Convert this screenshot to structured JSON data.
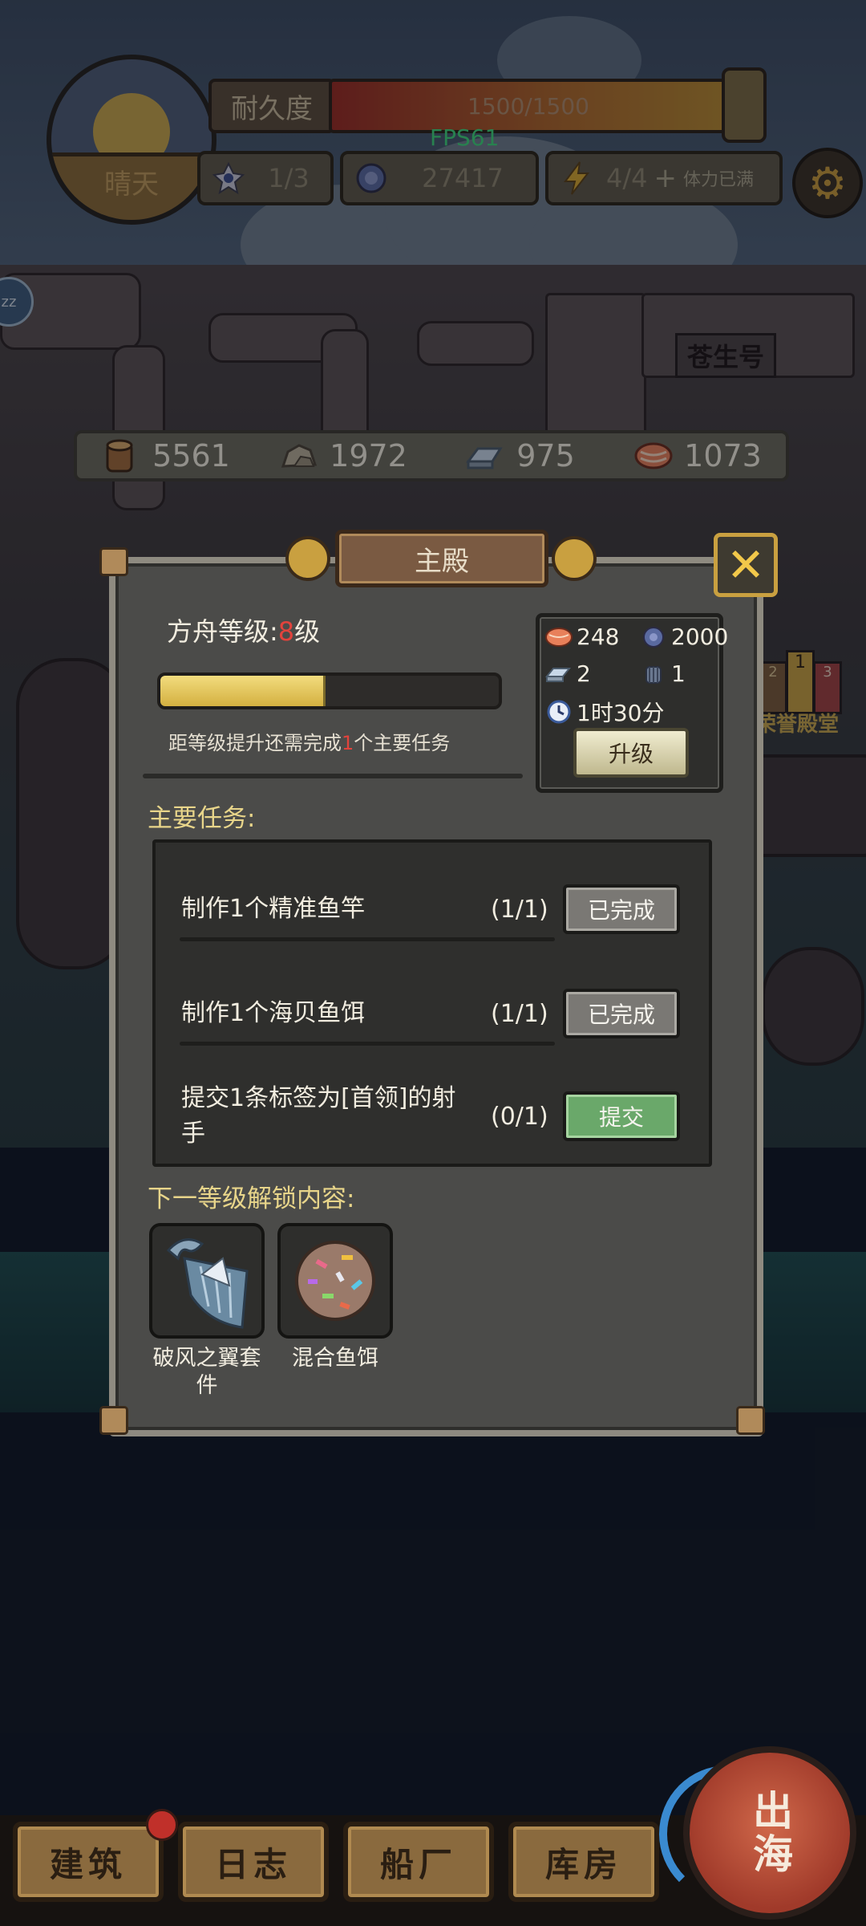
{
  "hud": {
    "weather": "晴天",
    "durability_label": "耐久度",
    "durability_value": "1500/1500",
    "durability_fraction": 1.0,
    "fps": "FPS61",
    "crew": "1/3",
    "coins": "27417",
    "energy": "4/4",
    "energy_plus": "+",
    "energy_status": "体力已满"
  },
  "scene": {
    "ship_name": "苍生号",
    "side_building": "荣誉殿堂",
    "side_ranks": [
      "2",
      "1",
      "3"
    ],
    "zz": "zz"
  },
  "resources": [
    {
      "icon": "wood-icon",
      "value": "5561"
    },
    {
      "icon": "stone-icon",
      "value": "1972"
    },
    {
      "icon": "iron-icon",
      "value": "975"
    },
    {
      "icon": "fish-meat-icon",
      "value": "1073"
    }
  ],
  "dialog": {
    "title": "主殿",
    "level_label": "方舟等级:",
    "level": "8",
    "level_unit": "级",
    "progress_fraction": 0.48,
    "hint_prefix": "距等级提升还需完成",
    "hint_count": "1",
    "hint_suffix": "个主要任务",
    "requirements": {
      "fish": "248",
      "coins": "2000",
      "iron": "2",
      "part": "1",
      "time": "1时30分"
    },
    "upgrade_label": "升级",
    "tasks_title": "主要任务:",
    "tasks": [
      {
        "name": "制作1个精准鱼竿",
        "count": "(1/1)",
        "button": "已完成"
      },
      {
        "name": "制作1个海贝鱼饵",
        "count": "(1/1)",
        "button": "已完成"
      },
      {
        "name": "提交1条标签为[首领]的射手",
        "count": "(0/1)",
        "button": "提交"
      }
    ],
    "unlock_title": "下一等级解锁内容:",
    "unlocks": [
      {
        "name": "破风之翼套件",
        "icon": "wing-kit-icon"
      },
      {
        "name": "混合鱼饵",
        "icon": "mixed-bait-icon"
      }
    ]
  },
  "nav": {
    "items": [
      "建筑",
      "日志",
      "船厂",
      "库房"
    ],
    "sea": "出海"
  },
  "colors": {
    "accent_gold": "#c9a040",
    "danger_red": "#e2433c",
    "fps_green": "#3ed67a",
    "submit_green": "#6aa86a"
  }
}
